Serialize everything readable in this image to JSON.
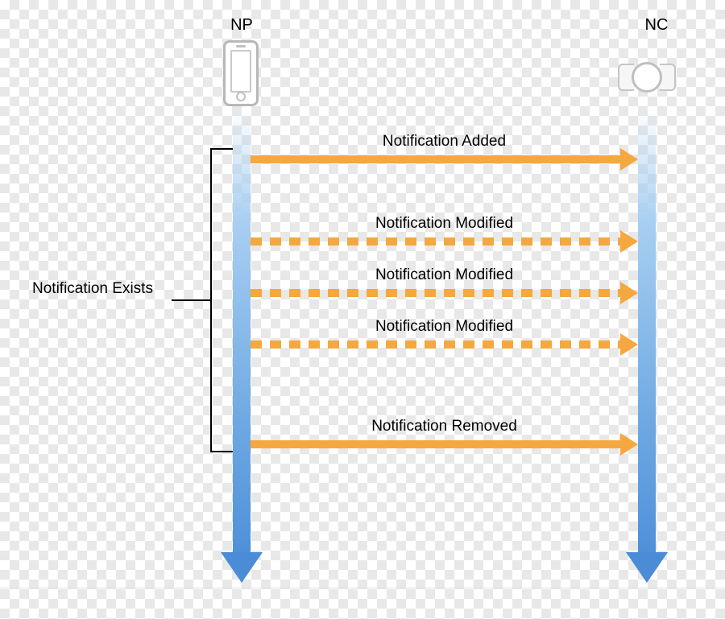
{
  "actors": {
    "np": {
      "label": "NP"
    },
    "nc": {
      "label": "NC"
    }
  },
  "bracket_label": "Notification Exists",
  "messages": {
    "added": {
      "label": "Notification Added"
    },
    "mod1": {
      "label": "Notification Modified"
    },
    "mod2": {
      "label": "Notification Modified"
    },
    "mod3": {
      "label": "Notification Modified"
    },
    "removed": {
      "label": "Notification Removed"
    }
  },
  "colors": {
    "arrow_orange": "#f4a83f",
    "lifeline_blue": "#4a8cd6"
  }
}
